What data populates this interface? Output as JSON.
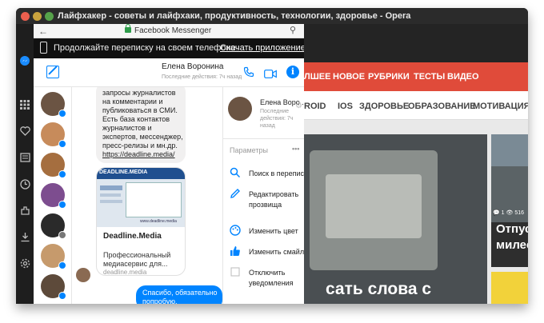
{
  "window": {
    "title": "Лайфхакер - советы и лайфхаки, продуктивность, технологии, здоровье - Opera"
  },
  "website": {
    "nav_primary": [
      "ЛШЕЕ",
      "НОВОЕ",
      "РУБРИКИ",
      "ТЕСТЫ",
      "ВИДЕО"
    ],
    "nav_secondary": [
      "ROID",
      "IOS",
      "ЗДОРОВЬЕ",
      "ОБРАЗОВАНИЕ",
      "МОТИВАЦИЯ"
    ],
    "hero_title": "сать слова с",
    "card_stats": "💬 1   👁 516",
    "card_title_lines": [
      "Отпуск",
      "милее"
    ]
  },
  "messenger": {
    "bar_title": "Facebook Messenger",
    "promo_text": "Продолжайте переписку на своем телефоне.",
    "promo_link": "Скачать приложение",
    "contact_name": "Елена Воронина",
    "contact_status": "Последние действия: 7ч назад",
    "contact_badge_colors": [
      "#0084ff",
      "#0084ff",
      "#0084ff",
      "#0084ff",
      "#777777",
      "#0084ff",
      "#0084ff",
      "#0084ff"
    ],
    "message_lines": [
      "запросы журналистов",
      "на комментарии и",
      "публиковаться в СМИ.",
      "Есть база контактов",
      "журналистов и",
      "экспертов, мессенджер,",
      "пресс-релизы и мн.др."
    ],
    "message_link": "https://deadline.media/",
    "link_card": {
      "logo": "DEADLINE.MEDIA",
      "image_url": "www.deadline.media",
      "title": "Deadline.Media",
      "desc_lines": [
        "Профессиональный",
        "медиасервис для..."
      ],
      "domain": "deadline.media"
    },
    "reply_lines": [
      "Спасибо, обязательно",
      "попробую."
    ],
    "info": {
      "name": "Елена Воро...",
      "status_lines": [
        "Последние",
        "действия: 7ч",
        "назад"
      ],
      "params_label": "Параметры",
      "items": [
        {
          "icon": "search-icon",
          "lines": [
            "Поиск в переписке"
          ]
        },
        {
          "icon": "pencil-icon",
          "lines": [
            "Редактировать",
            "прозвища"
          ]
        },
        {
          "icon": "palette-icon",
          "lines": [
            "Изменить цвет"
          ]
        },
        {
          "icon": "thumbs-up-icon",
          "lines": [
            "Изменить смайлик"
          ]
        },
        {
          "icon": "checkbox-icon",
          "lines": [
            "Отключить",
            "уведомления"
          ]
        }
      ]
    }
  },
  "colors": {
    "messenger_blue": "#0084ff",
    "site_red": "#e04b3a"
  }
}
